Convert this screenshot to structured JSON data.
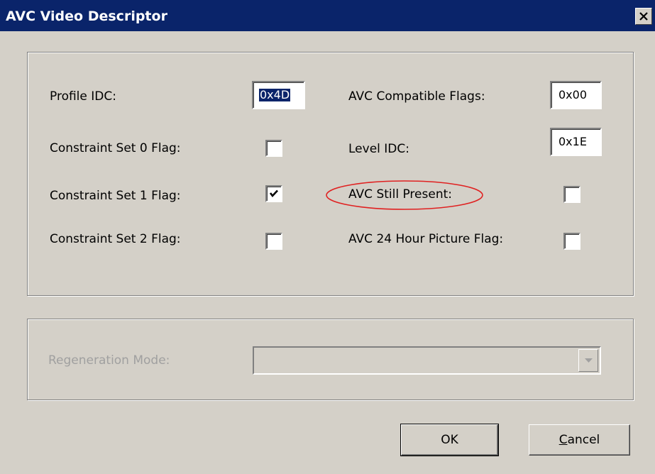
{
  "window": {
    "title": "AVC Video Descriptor"
  },
  "fields": {
    "profile_idc": {
      "label": "Profile IDC:",
      "value": "0x4D",
      "selected": true
    },
    "avc_compatible_flags": {
      "label": "AVC Compatible Flags:",
      "value": "0x00"
    },
    "constraint_set_0": {
      "label": "Constraint Set 0 Flag:",
      "checked": false
    },
    "level_idc": {
      "label": "Level IDC:",
      "value": "0x1E"
    },
    "constraint_set_1": {
      "label": "Constraint Set 1 Flag:",
      "checked": true
    },
    "avc_still_present": {
      "label": "AVC Still Present:",
      "checked": false,
      "highlighted": true,
      "highlight_color": "#e02020"
    },
    "constraint_set_2": {
      "label": "Constraint Set 2 Flag:",
      "checked": false
    },
    "avc_24_hour_picture": {
      "label": "AVC 24 Hour Picture Flag:",
      "checked": false
    }
  },
  "regeneration": {
    "label": "Regeneration Mode:",
    "value": "",
    "disabled": true
  },
  "buttons": {
    "ok": "OK",
    "cancel_first": "C",
    "cancel_rest": "ancel"
  },
  "colors": {
    "titlebar": "#0a246a",
    "face": "#d4d0c8"
  }
}
